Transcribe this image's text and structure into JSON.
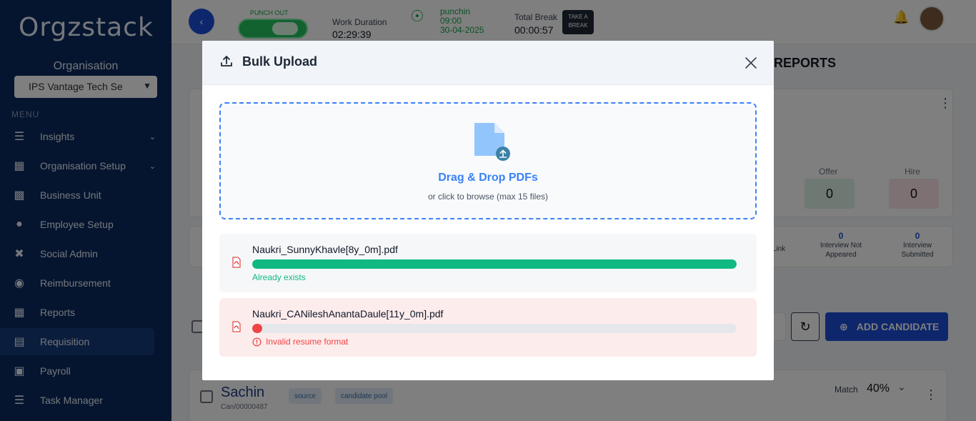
{
  "sidebar": {
    "logo": "Orgzstack",
    "org_label": "Organisation",
    "org_value": "IPS Vantage Tech Se",
    "menu_label": "MENU",
    "items": [
      {
        "label": "Insights",
        "icon": "insights-icon"
      },
      {
        "label": "Organisation Setup",
        "icon": "organisation-setup-icon"
      },
      {
        "label": "Business Unit",
        "icon": "briefcase-icon"
      },
      {
        "label": "Employee Setup",
        "icon": "employee-icon"
      },
      {
        "label": "Social Admin",
        "icon": "social-icon"
      },
      {
        "label": "Reimbursement",
        "icon": "reimbursement-icon"
      },
      {
        "label": "Reports",
        "icon": "reports-icon"
      },
      {
        "label": "Requisition",
        "icon": "requisition-icon"
      },
      {
        "label": "Payroll",
        "icon": "payroll-icon"
      },
      {
        "label": "Task Manager",
        "icon": "task-icon"
      }
    ]
  },
  "header": {
    "punch_label": "PUNCH OUT",
    "work_duration_label": "Work Duration",
    "work_duration_value": "02:29:39",
    "punchin_label": "punchin",
    "punchin_time": "09:00",
    "punchin_date": "30-04-2025",
    "total_break_label": "Total Break",
    "total_break_value": "00:00:57",
    "take_break_label": "TAKE A BREAK"
  },
  "page": {
    "reports_tab": "REPORTS",
    "offer_label": "Offer",
    "offer_value": "0",
    "hire_label": "Hire",
    "hire_value": "0",
    "link_label": "Link",
    "interview_not_appeared_value": "0",
    "interview_not_appeared_label": "Interview Not Appeared",
    "interview_submitted_value": "0",
    "interview_submitted_label": "Interview Submitted",
    "add_candidate_label": "ADD CANDIDATE",
    "candidate": {
      "name": "Sachin",
      "id": "Can/00000487",
      "tags": [
        "source",
        "candidate pool"
      ],
      "match_label": "Match",
      "match_value": "40%"
    }
  },
  "modal": {
    "title": "Bulk Upload",
    "dropzone_title": "Drag & Drop PDFs",
    "dropzone_subtitle": "or click to browse (max 15 files)",
    "files": [
      {
        "name": "Naukri_SunnyKhavle[8y_0m].pdf",
        "progress": 1.0,
        "status": "Already exists",
        "state": "ok"
      },
      {
        "name": "Naukri_CANileshAnantaDaule[11y_0m].pdf",
        "progress": 0.02,
        "status": "Invalid resume format",
        "state": "error"
      }
    ]
  },
  "colors": {
    "accent": "#3b82f6",
    "success": "#10b981",
    "error": "#ef4444",
    "sidebar": "#0b2a5e"
  }
}
